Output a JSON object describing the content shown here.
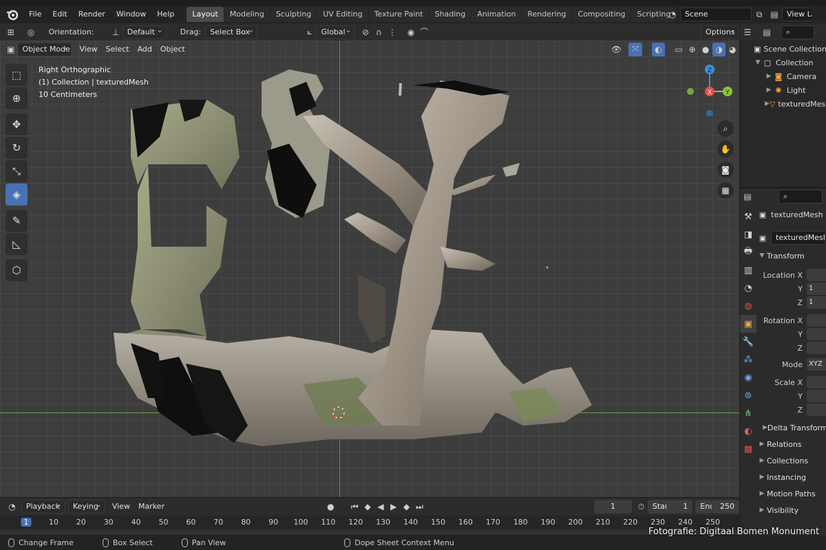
{
  "app": {
    "menu": [
      "File",
      "Edit",
      "Render",
      "Window",
      "Help"
    ],
    "workspaces": [
      "Layout",
      "Modeling",
      "Sculpting",
      "UV Editing",
      "Texture Paint",
      "Shading",
      "Animation",
      "Rendering",
      "Compositing",
      "Scripting"
    ],
    "active_workspace": "Layout",
    "add_tab": "+",
    "scene": "Scene",
    "view_layer": "View Lay"
  },
  "viewport_header": {
    "orientation_label": "Orientation:",
    "orientation_value": "Default",
    "drag_label": "Drag:",
    "drag_value": "Select Box",
    "transform_space": "Global",
    "options": "Options",
    "mode": "Object Mode",
    "menus": [
      "View",
      "Select",
      "Add",
      "Object"
    ]
  },
  "viewport": {
    "view_name": "Right Orthographic",
    "collection_info": "(1) Collection | texturedMesh",
    "scale": "10 Centimeters",
    "gizmo": {
      "z": "Z",
      "x": "X",
      "y": "Y"
    }
  },
  "outliner": {
    "items": [
      {
        "label": "Scene Collection",
        "icon": "scene-collection-icon"
      },
      {
        "label": "Collection",
        "icon": "collection-icon"
      },
      {
        "label": "Camera",
        "icon": "camera-icon"
      },
      {
        "label": "Light",
        "icon": "light-icon"
      },
      {
        "label": "texturedMesh",
        "icon": "mesh-icon"
      }
    ]
  },
  "properties": {
    "object_name": "texturedMesh",
    "data_name": "texturedMesh",
    "transform_title": "Transform",
    "location_label": "Location X",
    "rotation_label": "Rotation X",
    "scale_label": "Scale X",
    "y": "Y",
    "z": "Z",
    "loc_y_val": "1",
    "loc_z_val": "1",
    "mode_label": "Mode",
    "mode_value": "XYZ",
    "delta_transform": "Delta Transform",
    "sections": [
      "Relations",
      "Collections",
      "Instancing",
      "Motion Paths",
      "Visibility"
    ]
  },
  "timeline": {
    "menus": [
      "Playback",
      "Keying",
      "View",
      "Marker"
    ],
    "current_frame": "1",
    "start_label": "Start",
    "start": "1",
    "end_label": "End",
    "end": "250",
    "ticks": [
      "1",
      "10",
      "20",
      "30",
      "40",
      "50",
      "60",
      "70",
      "80",
      "90",
      "100",
      "110",
      "120",
      "130",
      "140",
      "150",
      "160",
      "170",
      "180",
      "190",
      "200",
      "210",
      "220",
      "230",
      "240",
      "250"
    ]
  },
  "statusbar": {
    "items": [
      "Change Frame",
      "Box Select",
      "Pan View",
      "Dope Sheet Context Menu"
    ]
  },
  "credit": "Fotografie: Digitaal Bomen Monument",
  "colors": {
    "accent": "#4772b3",
    "x_axis": "#e84d4d",
    "y_axis": "#8bc43e",
    "z_axis": "#3d8fdc"
  }
}
